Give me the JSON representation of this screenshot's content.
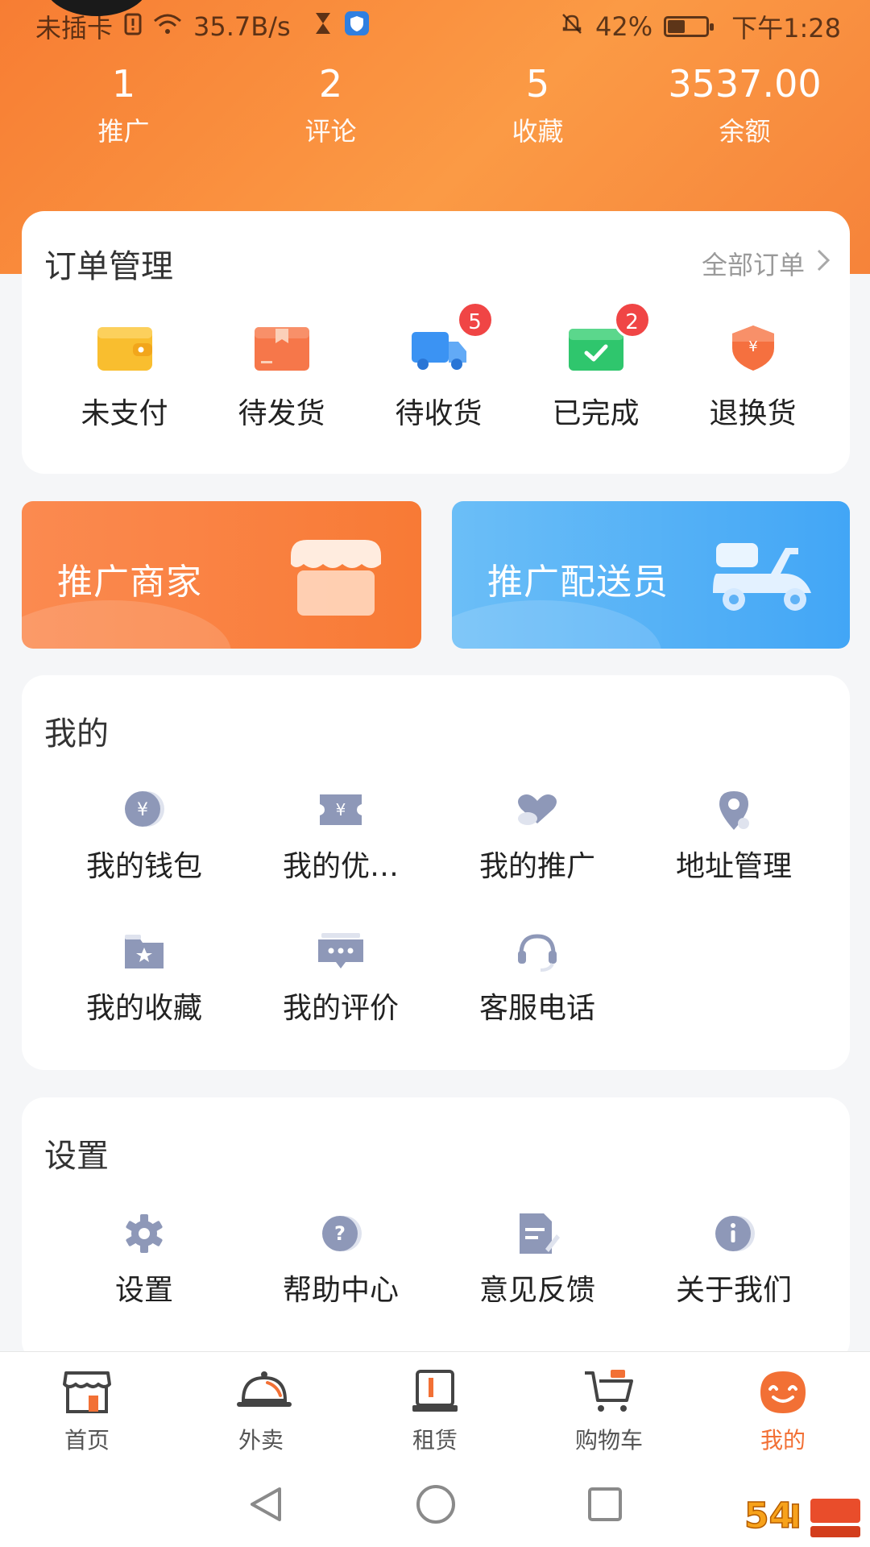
{
  "status_bar": {
    "carrier": "未插卡",
    "speed": "35.7B/s",
    "battery": "42%",
    "time": "下午1:28"
  },
  "stats": [
    {
      "value": "1",
      "label": "推广"
    },
    {
      "value": "2",
      "label": "评论"
    },
    {
      "value": "5",
      "label": "收藏"
    },
    {
      "value": "3537.00",
      "label": "余额"
    }
  ],
  "orders": {
    "title": "订单管理",
    "all_link": "全部订单",
    "items": [
      {
        "label": "未支付",
        "icon": "wallet-icon"
      },
      {
        "label": "待发货",
        "icon": "package-icon"
      },
      {
        "label": "待收货",
        "icon": "truck-icon",
        "badge": "5"
      },
      {
        "label": "已完成",
        "icon": "completed-icon",
        "badge": "2"
      },
      {
        "label": "退换货",
        "icon": "refund-shield-icon"
      }
    ]
  },
  "promos": {
    "merchant": "推广商家",
    "rider": "推广配送员"
  },
  "mine": {
    "title": "我的",
    "items": [
      {
        "label": "我的钱包",
        "icon": "wallet-coin-icon"
      },
      {
        "label": "我的优…",
        "icon": "coupon-icon"
      },
      {
        "label": "我的推广",
        "icon": "heart-icon"
      },
      {
        "label": "地址管理",
        "icon": "location-pin-icon"
      },
      {
        "label": "我的收藏",
        "icon": "favorite-folder-icon"
      },
      {
        "label": "我的评价",
        "icon": "comment-icon"
      },
      {
        "label": "客服电话",
        "icon": "headset-icon"
      }
    ]
  },
  "settings": {
    "title": "设置",
    "items": [
      {
        "label": "设置",
        "icon": "gear-icon"
      },
      {
        "label": "帮助中心",
        "icon": "help-icon"
      },
      {
        "label": "意见反馈",
        "icon": "feedback-icon"
      },
      {
        "label": "关于我们",
        "icon": "info-icon"
      }
    ]
  },
  "tabs": [
    {
      "label": "首页",
      "icon": "home-store-icon"
    },
    {
      "label": "外卖",
      "icon": "food-cloche-icon"
    },
    {
      "label": "租赁",
      "icon": "rental-icon"
    },
    {
      "label": "购物车",
      "icon": "cart-icon"
    },
    {
      "label": "我的",
      "icon": "profile-smile-icon",
      "active": true
    }
  ],
  "colors": {
    "accent": "#f27035",
    "header_gradient_start": "#f77d33",
    "rider_blue": "#42a6f6",
    "icon_gray": "#8e98b8",
    "badge_red": "#f04545"
  }
}
